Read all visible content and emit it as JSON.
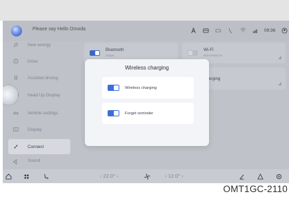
{
  "status_bar": {
    "greeting": "Please say Hello Omoda",
    "time": "09:36",
    "icons": [
      "a-icon",
      "card-icon",
      "battery-icon",
      "phone-icon",
      "signal-icon",
      "wifi-icon",
      "user-icon"
    ]
  },
  "sidebar": {
    "items": [
      {
        "label": "New energy",
        "icon": "leaf-icon"
      },
      {
        "label": "Drive",
        "icon": "steering-icon"
      },
      {
        "label": "Assisted driving",
        "icon": "assist-icon"
      },
      {
        "label": "Head Up Display",
        "icon": "hud-icon"
      },
      {
        "label": "Vehicle settings",
        "icon": "car-icon"
      },
      {
        "label": "Display",
        "icon": "display-icon"
      },
      {
        "label": "Connect",
        "icon": "link-icon"
      },
      {
        "label": "Sound",
        "icon": "sound-icon"
      }
    ],
    "active": "Connect"
  },
  "cards": {
    "bluetooth": {
      "title": "Bluetooth",
      "subtitle": "Active",
      "toggle": "on"
    },
    "wifi": {
      "title": "Wi-Fi",
      "subtitle": "Not turned on",
      "toggle": "off"
    },
    "charging_partial": "arging"
  },
  "dialog": {
    "title": "Wireless charging",
    "options": [
      {
        "label": "Wireless charging",
        "state": "on"
      },
      {
        "label": "Forget reminder",
        "state": "on"
      }
    ]
  },
  "dock": {
    "temp_left": "22.0° ›",
    "temp_right": "12.0° ›",
    "temp_left_prefix": "‹",
    "temp_right_prefix": "‹",
    "icons": [
      "home-icon",
      "apps-icon",
      "seat-icon",
      "fan-icon",
      "heat-icon",
      "warning-icon",
      "settings-icon"
    ]
  },
  "doc_code": "OMT1GC-2110",
  "colors": {
    "accent": "#3d6fd6",
    "screen_bg": "#bfc2c8",
    "dialog_bg": "#f3f4f7"
  }
}
